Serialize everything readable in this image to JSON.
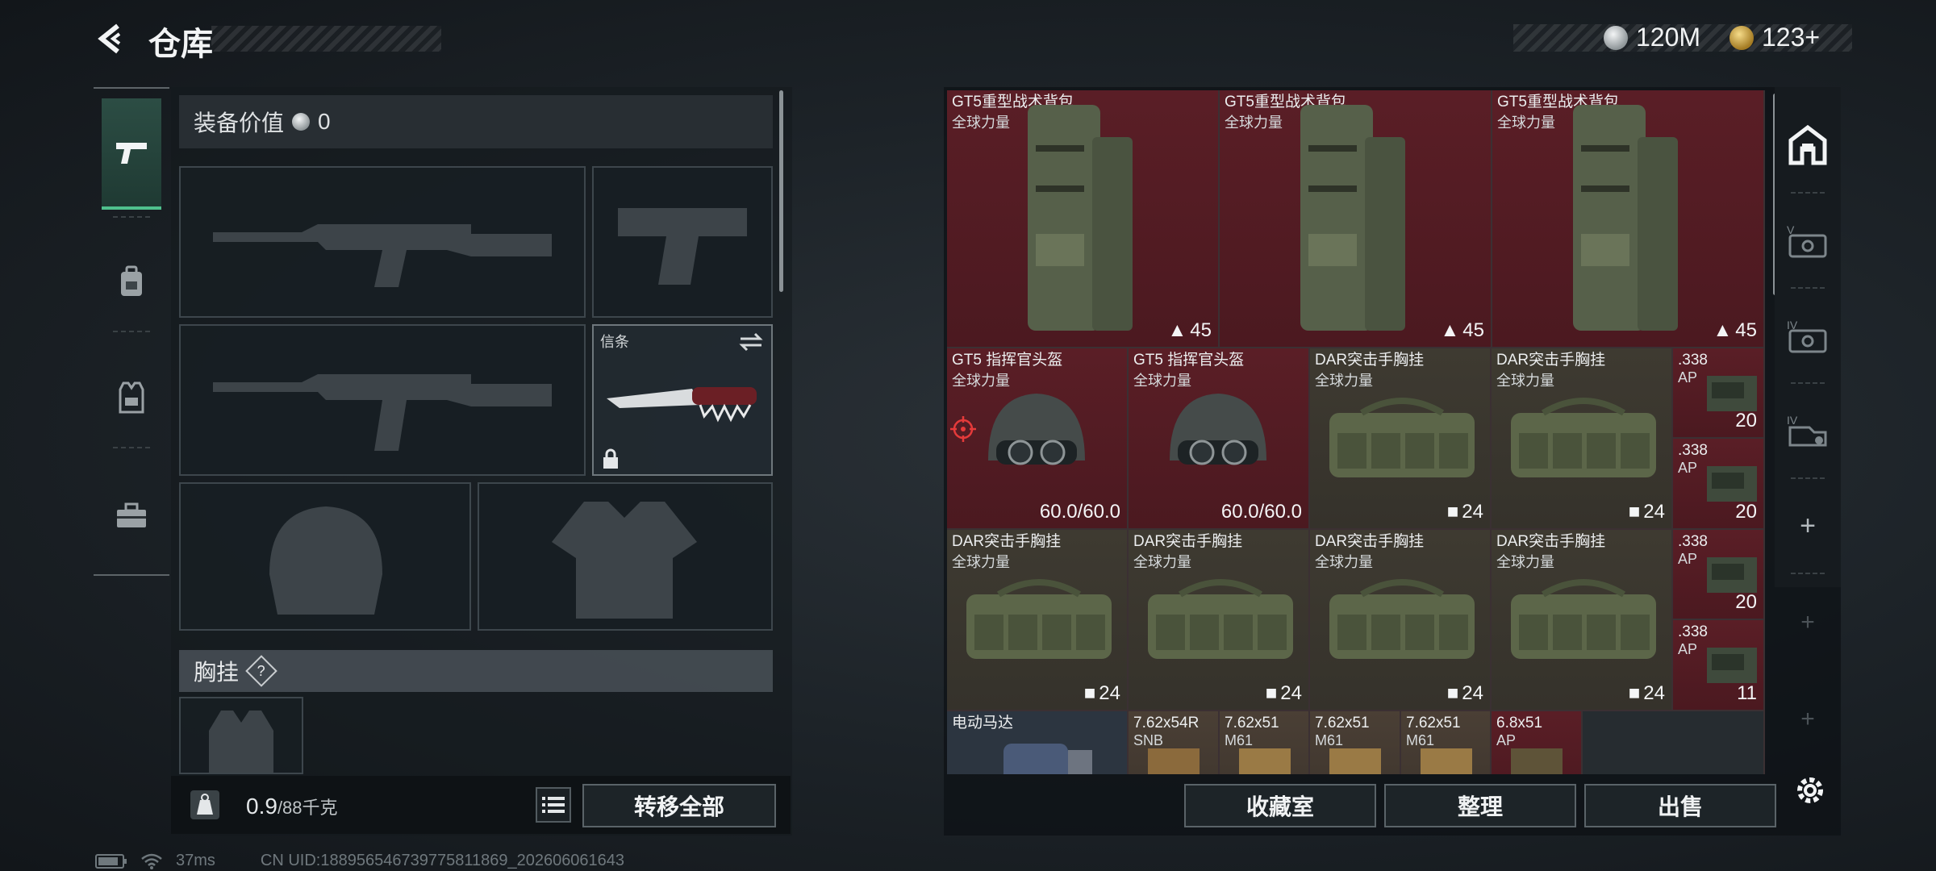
{
  "header": {
    "title": "仓库",
    "currency_silver": "120M",
    "currency_gold": "123+"
  },
  "rail": {
    "tabs": [
      {
        "icon": "pistol-icon",
        "active": true
      },
      {
        "icon": "backpack-icon",
        "active": false
      },
      {
        "icon": "vest-icon",
        "active": false
      },
      {
        "icon": "toolbox-icon",
        "active": false
      }
    ]
  },
  "loadout": {
    "equipment_value_label": "装备价值",
    "equipment_value": "0",
    "knife_label": "信条",
    "chest_rig_label": "胸挂",
    "chest_rig_help": "?",
    "weight_value": "0.9",
    "weight_unit": "/88千克",
    "transfer_all_label": "转移全部"
  },
  "storage": {
    "backpacks": [
      {
        "name": "GT5重型战术背包",
        "sub": "全球力量",
        "count": "45"
      },
      {
        "name": "GT5重型战术背包",
        "sub": "全球力量",
        "count": "45"
      },
      {
        "name": "GT5重型战术背包",
        "sub": "全球力量",
        "count": "45"
      }
    ],
    "row2": [
      {
        "name": "GT5 指挥官头盔",
        "sub": "全球力量",
        "durability": "60.0/60.0"
      },
      {
        "name": "GT5 指挥官头盔",
        "sub": "全球力量",
        "durability": "60.0/60.0"
      },
      {
        "name": "DAR突击手胸挂",
        "sub": "全球力量",
        "count": "24"
      },
      {
        "name": "DAR突击手胸挂",
        "sub": "全球力量",
        "count": "24"
      }
    ],
    "row3": [
      {
        "name": "DAR突击手胸挂",
        "sub": "全球力量",
        "count": "24"
      },
      {
        "name": "DAR突击手胸挂",
        "sub": "全球力量",
        "count": "24"
      },
      {
        "name": "DAR突击手胸挂",
        "sub": "全球力量",
        "count": "24"
      },
      {
        "name": "DAR突击手胸挂",
        "sub": "全球力量",
        "count": "24"
      }
    ],
    "ammo_338": [
      {
        "name": ".338",
        "sub": "AP",
        "count": "20"
      },
      {
        "name": ".338",
        "sub": "AP",
        "count": "20"
      },
      {
        "name": ".338",
        "sub": "AP",
        "count": "20"
      },
      {
        "name": ".338",
        "sub": "AP",
        "count": "11"
      }
    ],
    "row4": [
      {
        "name": "电动马达",
        "sub": ""
      },
      {
        "name": "7.62x54R",
        "sub": "SNB"
      },
      {
        "name": "7.62x51",
        "sub": "M61"
      },
      {
        "name": "7.62x51",
        "sub": "M61"
      },
      {
        "name": "7.62x51",
        "sub": "M61"
      },
      {
        "name": "6.8x51",
        "sub": "AP"
      }
    ],
    "actions": {
      "collection_label": "收藏室",
      "organize_label": "整理",
      "sell_label": "出售"
    },
    "tools": [
      "home-filter-icon",
      "tier-v-case-icon",
      "tier-iv-case-icon",
      "tier-iv-key-icon",
      "+",
      "+",
      "+"
    ]
  },
  "status": {
    "latency": "37ms",
    "uid": "CN UID:188956546739775811869_202606061643"
  },
  "colors": {
    "accent_green": "#4fc08d",
    "red_tier": "#5a1e26",
    "olive_tier": "#3e3a31"
  }
}
